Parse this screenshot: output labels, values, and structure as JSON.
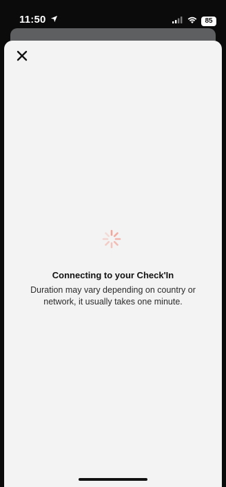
{
  "status_bar": {
    "time": "11:50",
    "battery": "85"
  },
  "modal": {
    "close_icon": "close-icon",
    "loading_icon": "spinner-icon",
    "title": "Connecting to your Check'In",
    "subtitle": "Duration may vary depending on country or network, it usually takes one minute."
  },
  "colors": {
    "sheet_background": "#f3f3f3",
    "spinner": "#f2a59a",
    "text": "#111111"
  }
}
